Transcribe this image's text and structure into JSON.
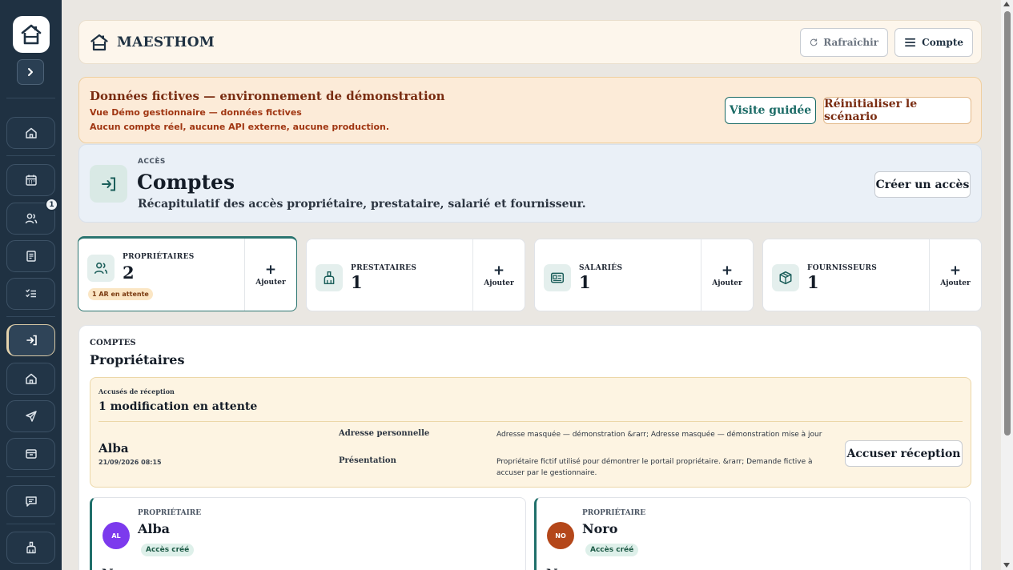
{
  "app": {
    "name": "MAESTHOM"
  },
  "header": {
    "refresh_label": "Rafraîchir",
    "account_label": "Compte"
  },
  "sidebar": {
    "badge_users": "1",
    "items": [
      "home-icon",
      "calendar-icon",
      "users-icon",
      "document-icon",
      "checklist-icon",
      "login-icon",
      "house-icon",
      "send-icon",
      "inbox-icon",
      "message-icon",
      "broom-icon"
    ]
  },
  "demo": {
    "title": "Données fictives — environnement de démonstration",
    "line1": "Vue Démo gestionnaire — données fictives",
    "line2": "Aucun compte réel, aucune API externe, aucune production.",
    "tour_label": "Visite guidée",
    "reset_label": "Réinitialiser le scénario"
  },
  "page": {
    "kicker": "ACCÈS",
    "title": "Comptes",
    "subtitle": "Récapitulatif des accès propriétaire, prestataire, salarié et fournisseur.",
    "create_label": "Créer un accès"
  },
  "stats": [
    {
      "label": "PROPRIÉTAIRES",
      "value": "2",
      "pill": "1 AR en attente",
      "add_plus": "+",
      "add_label": "Ajouter"
    },
    {
      "label": "PRESTATAIRES",
      "value": "1",
      "add_plus": "+",
      "add_label": "Ajouter"
    },
    {
      "label": "SALARIÉS",
      "value": "1",
      "add_plus": "+",
      "add_label": "Ajouter"
    },
    {
      "label": "FOURNISSEURS",
      "value": "1",
      "add_plus": "+",
      "add_label": "Ajouter"
    }
  ],
  "accounts": {
    "kicker": "COMPTES",
    "title": "Propriétaires",
    "ack": {
      "kicker": "Accusés de réception",
      "title": "1 modification en attente",
      "name": "Alba",
      "date": "21/09/2026 08:15",
      "field1": "Adresse personnelle",
      "change1": "Adresse masquée — démonstration &rarr; Adresse masquée — démonstration mise à jour",
      "field2": "Présentation",
      "change2": "Propriétaire fictif utilisé pour démontrer le portail propriétaire. &rarr; Demande fictive à accuser par le gestionnaire.",
      "button_label": "Accuser réception"
    },
    "owners": [
      {
        "kicker": "PROPRIÉTAIRE",
        "initials": "AL",
        "name": "Alba",
        "status": "Accès créé",
        "more": "N",
        "color": "#7c3aed"
      },
      {
        "kicker": "PROPRIÉTAIRE",
        "initials": "NO",
        "name": "Noro",
        "status": "Accès créé",
        "more": "N",
        "color": "#b4471a"
      }
    ]
  }
}
